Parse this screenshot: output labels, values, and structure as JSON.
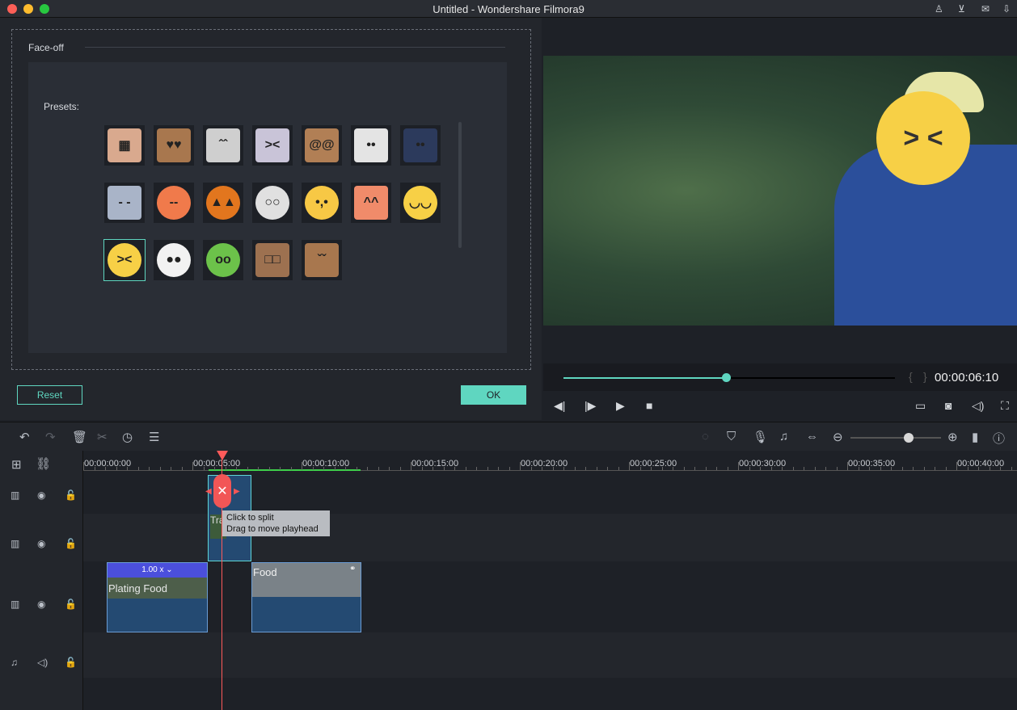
{
  "window": {
    "title": "Untitled - Wondershare Filmora9",
    "icons": [
      "user-icon",
      "cart-icon",
      "mail-icon",
      "download-icon"
    ]
  },
  "faceoff": {
    "title": "Face-off",
    "presets_label": "Presets:",
    "selected_index": 14,
    "presets": [
      {
        "name": "mosaic",
        "color": "#d9a98e",
        "glyph": "▦"
      },
      {
        "name": "box-heart-eyes",
        "color": "#a8774e",
        "glyph": "♥♥"
      },
      {
        "name": "cat-grey",
        "color": "#cfcfcf",
        "glyph": "ˆˆ"
      },
      {
        "name": "cat-angry",
        "color": "#c9c4d8",
        "glyph": "><"
      },
      {
        "name": "box-dizzy",
        "color": "#b17f55",
        "glyph": "@@"
      },
      {
        "name": "cat-white",
        "color": "#e4e4e4",
        "glyph": "••"
      },
      {
        "name": "husky",
        "color": "#2c3a5c",
        "glyph": "••"
      },
      {
        "name": "cat-blue",
        "color": "#a9b4c8",
        "glyph": "- -"
      },
      {
        "name": "angry-face",
        "color": "#f07a4b",
        "glyph": "--"
      },
      {
        "name": "pumpkin",
        "color": "#e2761e",
        "glyph": "▲▲"
      },
      {
        "name": "skull",
        "color": "#e0e0e0",
        "glyph": "○○"
      },
      {
        "name": "sad-face",
        "color": "#f7c845",
        "glyph": "•,•"
      },
      {
        "name": "fox",
        "color": "#f08b6a",
        "glyph": "^^"
      },
      {
        "name": "blush-face",
        "color": "#f7d046",
        "glyph": "◡◡"
      },
      {
        "name": "laughing-face",
        "color": "#f7d046",
        "glyph": "><"
      },
      {
        "name": "panda",
        "color": "#f2f2f2",
        "glyph": "●●"
      },
      {
        "name": "frog",
        "color": "#6cc24a",
        "glyph": "oo"
      },
      {
        "name": "box-zombie",
        "color": "#9d7150",
        "glyph": "□□"
      },
      {
        "name": "box-frown",
        "color": "#a8774e",
        "glyph": "ˇˇ"
      }
    ],
    "reset": "Reset",
    "ok": "OK"
  },
  "player": {
    "timecode": "00:00:06:10",
    "progress": 0.49,
    "face_glyph": "> <"
  },
  "timeline": {
    "ruler": [
      "00:00:00:00",
      "00:00:05:00",
      "00:00:10:00",
      "00:00:15:00",
      "00:00:20:00",
      "00:00:25:00",
      "00:00:30:00",
      "00:00:35:00",
      "00:00:40:00"
    ],
    "tooltip": {
      "line1": "Click to split",
      "line2": "Drag to move playhead"
    },
    "clips": {
      "speed": "1.00 x",
      "plating": "Plating Food",
      "food": "Food",
      "transition": "Tra"
    },
    "zoom_level": 0.55
  }
}
